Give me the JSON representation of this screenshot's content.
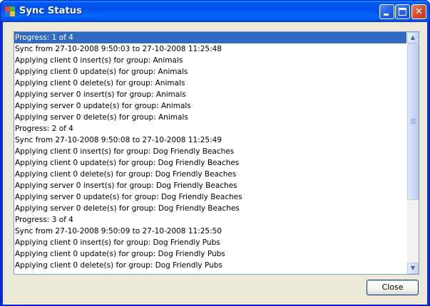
{
  "window": {
    "title": "Sync Status",
    "buttons": {
      "minimize": "",
      "maximize": "",
      "close": "✕"
    }
  },
  "log": {
    "selected_index": 0,
    "lines": [
      "Progress: 1 of 4",
      "Sync from 27-10-2008 9:50:03 to 27-10-2008 11:25:48",
      "Applying client 0 insert(s) for group: Animals",
      "Applying client 0 update(s) for group: Animals",
      "Applying client 0 delete(s) for group: Animals",
      "Applying server 0 insert(s) for group: Animals",
      "Applying server 0 update(s) for group: Animals",
      "Applying server 0 delete(s) for group: Animals",
      "Progress: 2 of 4",
      "Sync from 27-10-2008 9:50:08 to 27-10-2008 11:25:49",
      "Applying client 0 insert(s) for group: Dog Friendly Beaches",
      "Applying client 0 update(s) for group: Dog Friendly Beaches",
      "Applying client 0 delete(s) for group: Dog Friendly Beaches",
      "Applying server 0 insert(s) for group: Dog Friendly Beaches",
      "Applying server 0 update(s) for group: Dog Friendly Beaches",
      "Applying server 0 delete(s) for group: Dog Friendly Beaches",
      "Progress: 3 of 4",
      "Sync from 27-10-2008 9:50:09 to 27-10-2008 11:25:50",
      "Applying client 0 insert(s) for group: Dog Friendly Pubs",
      "Applying client 0 update(s) for group: Dog Friendly Pubs",
      "Applying client 0 delete(s) for group: Dog Friendly Pubs"
    ]
  },
  "scrollbar": {
    "up_arrow": "▲",
    "down_arrow": "▼"
  },
  "footer": {
    "close_label": "Close"
  }
}
